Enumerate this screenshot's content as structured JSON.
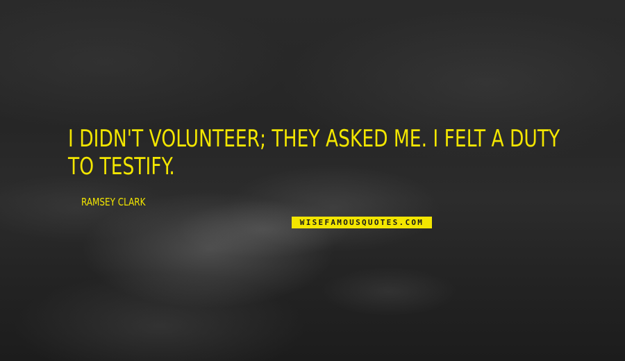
{
  "quote": {
    "text": "I didn't volunteer; they asked me. I felt a duty to testify."
  },
  "author": {
    "name": "Ramsey Clark"
  },
  "watermark": {
    "text": "WISEFAMOUSQUOTES.COM"
  },
  "colors": {
    "accent": "#f3e600",
    "background": "#262626"
  }
}
